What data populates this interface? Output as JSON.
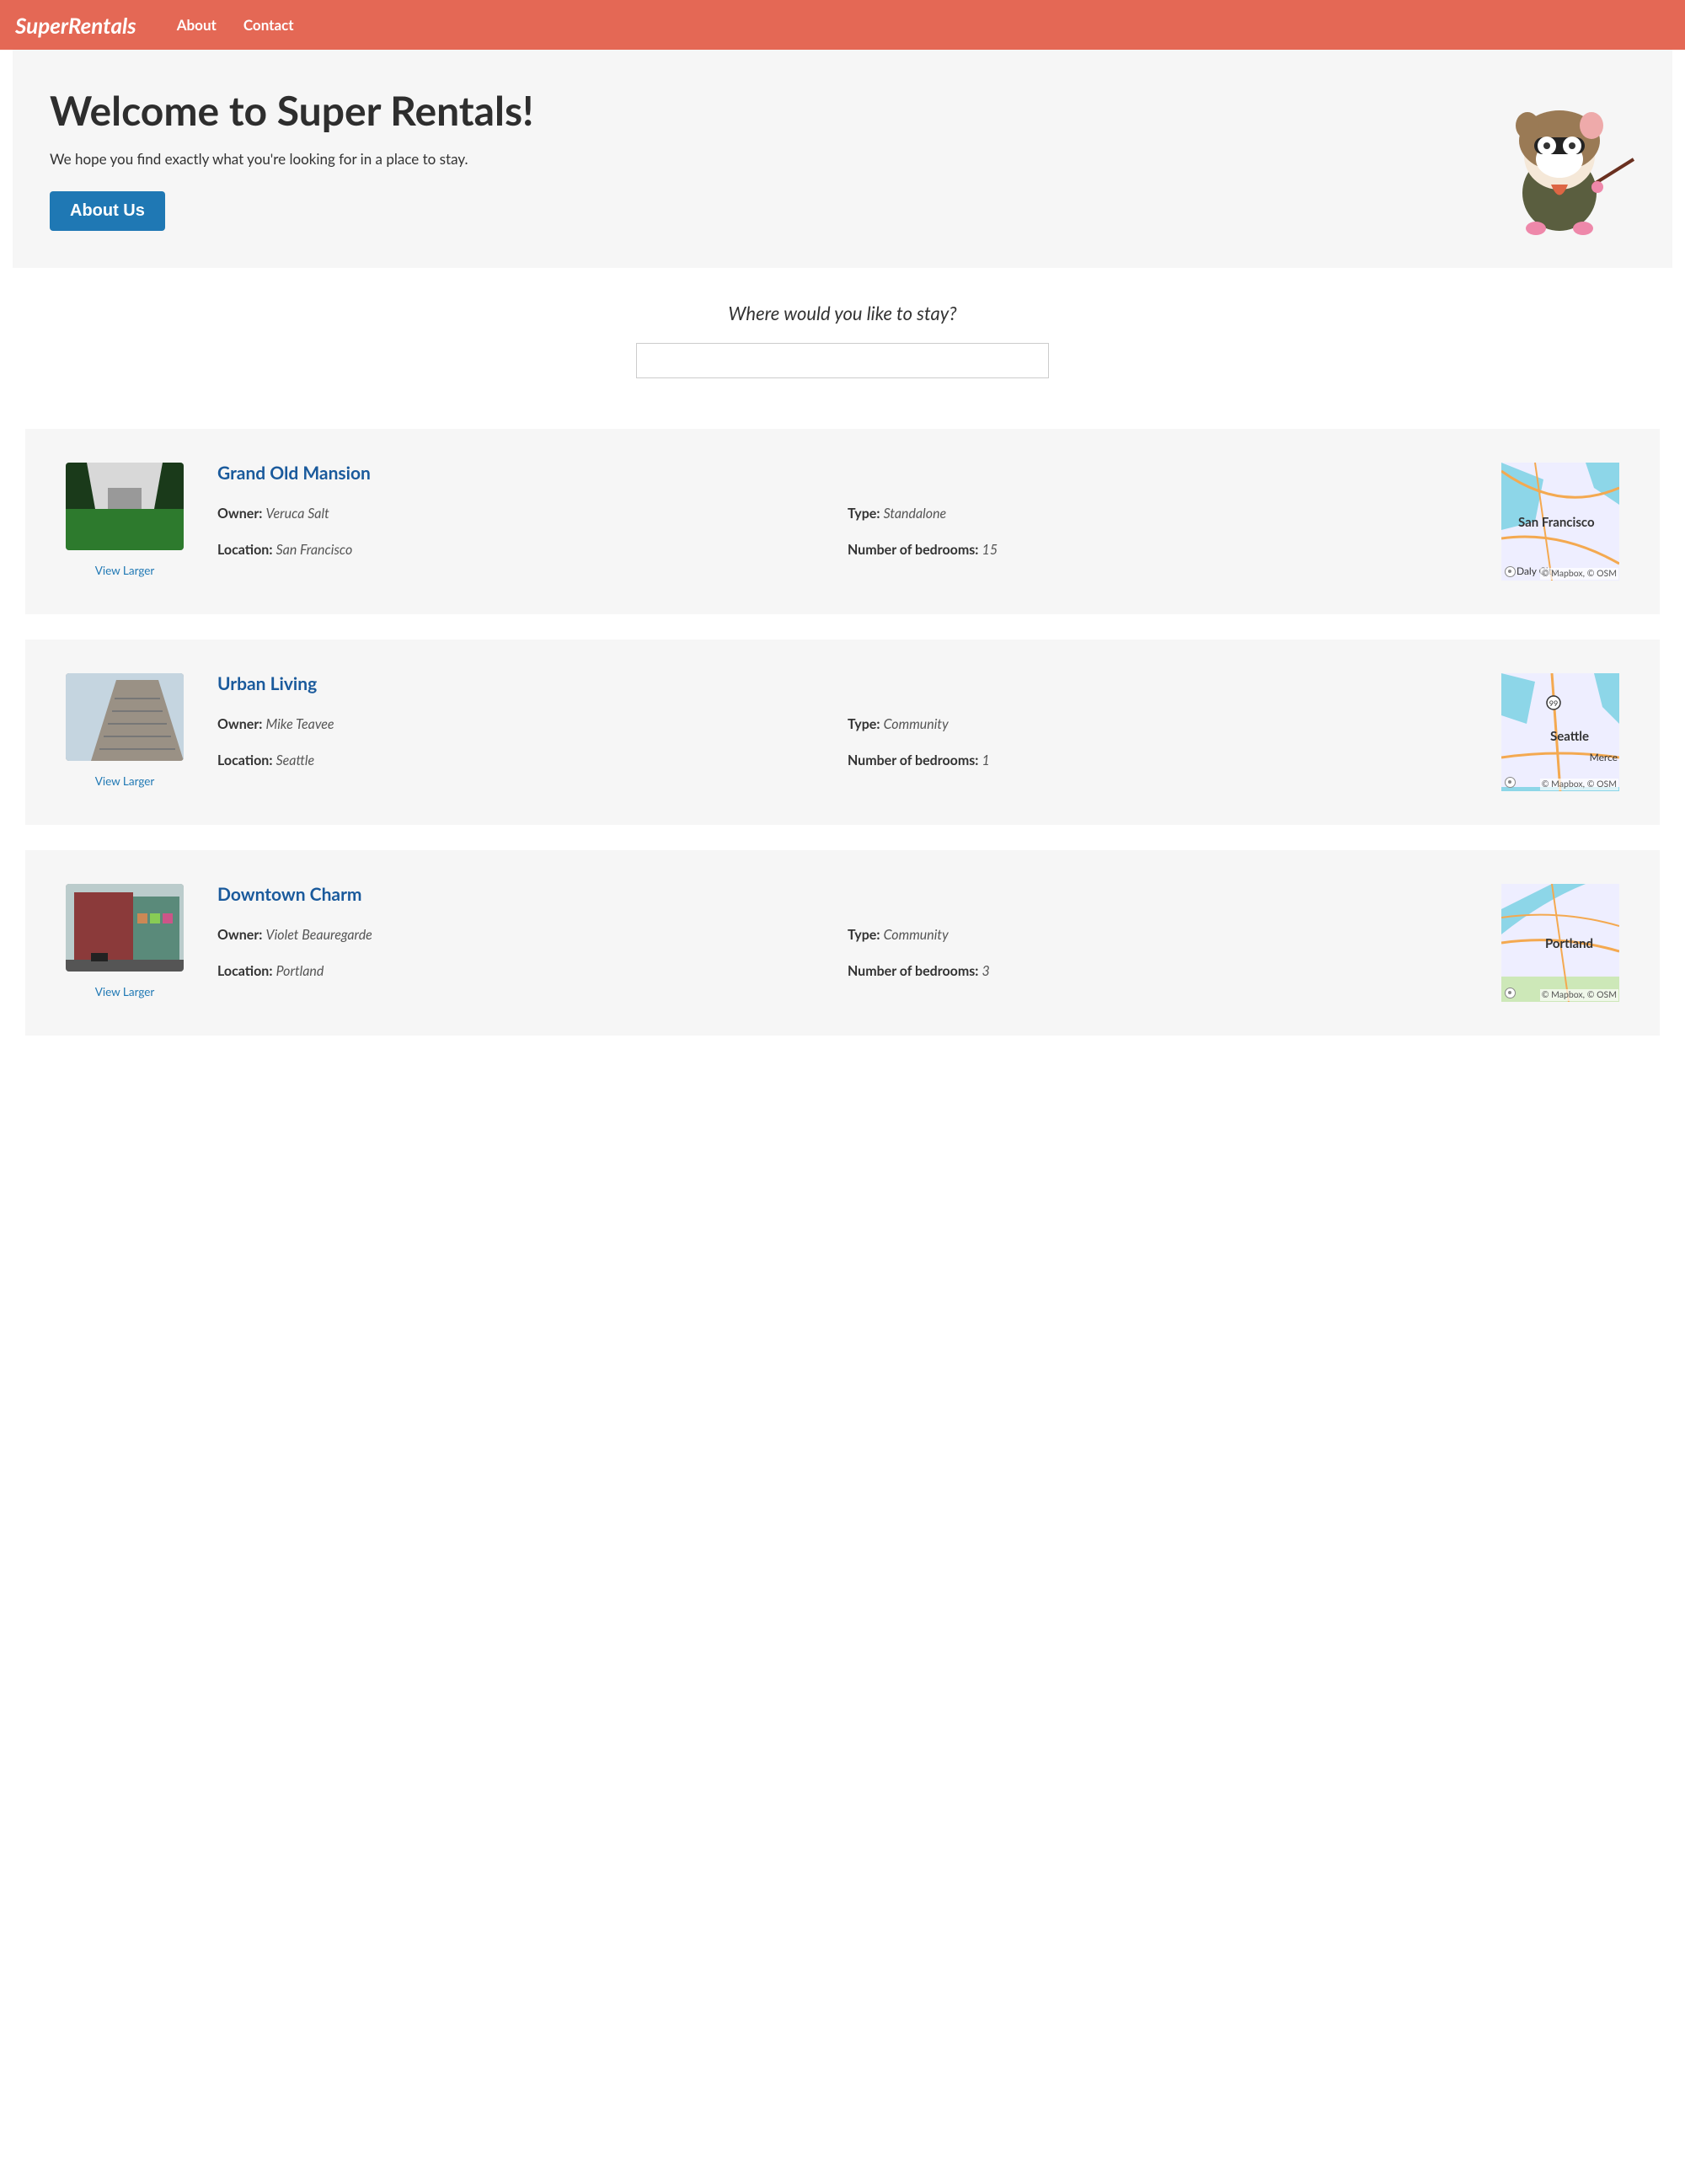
{
  "nav": {
    "logo": "SuperRentals",
    "links": [
      "About",
      "Contact"
    ]
  },
  "jumbo": {
    "title": "Welcome to Super Rentals!",
    "subtitle": "We hope you find exactly what you're looking for in a place to stay.",
    "button": "About Us"
  },
  "search": {
    "label": "Where would you like to stay?",
    "value": ""
  },
  "labels": {
    "owner": "Owner:",
    "type": "Type:",
    "location": "Location:",
    "bedrooms": "Number of bedrooms:",
    "view_larger": "View Larger",
    "map_attr": "© Mapbox, © OSM"
  },
  "rentals": [
    {
      "title": "Grand Old Mansion",
      "owner": "Veruca Salt",
      "type": "Standalone",
      "location": "San Francisco",
      "bedrooms": "15",
      "map_city": "San Francisco",
      "map_sub": "Daly City"
    },
    {
      "title": "Urban Living",
      "owner": "Mike Teavee",
      "type": "Community",
      "location": "Seattle",
      "bedrooms": "1",
      "map_city": "Seattle",
      "map_sub": "Merce"
    },
    {
      "title": "Downtown Charm",
      "owner": "Violet Beauregarde",
      "type": "Community",
      "location": "Portland",
      "bedrooms": "3",
      "map_city": "Portland",
      "map_sub": ""
    }
  ]
}
